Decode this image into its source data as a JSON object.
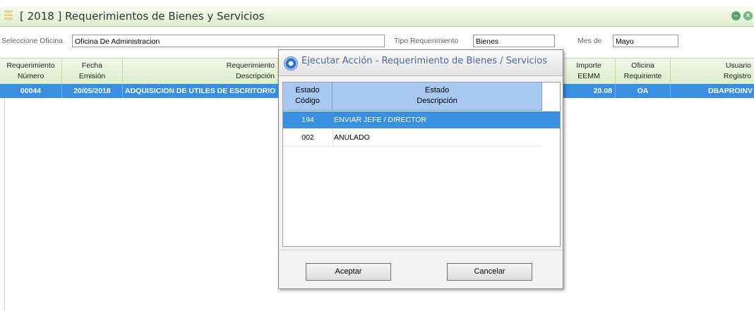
{
  "title": "[ 2018 ] Requerimientos de Bienes y Servicios",
  "filters": {
    "oficina_label": "Seleccione Oficina",
    "oficina_value": "Oficina De Administracion",
    "tipo_label": "Tipo Requerimiento",
    "tipo_value": "Bienes",
    "mes_label": "Mes de",
    "mes_value": "Mayo"
  },
  "grid": {
    "headers": [
      [
        "Requerimiento",
        "Número"
      ],
      [
        "Fecha",
        "Emisión"
      ],
      [
        "Requerimiento",
        "Descripción"
      ],
      [
        "Importe",
        "EEMM"
      ],
      [
        "Oficina",
        "Requiriente"
      ],
      [
        "Usuario",
        "Registro"
      ]
    ],
    "rows": [
      {
        "numero": "00044",
        "fecha": "20/05/2018",
        "descripcion": "ADQUISICION DE UTILES DE ESCRITORIO",
        "importe": "20.08",
        "oficina": "OA",
        "usuario": "DBAPROINV"
      }
    ]
  },
  "dialog": {
    "title": "Ejecutar Acción - Requerimiento de Bienes / Servicios",
    "headers": [
      [
        "Estado",
        "Código"
      ],
      [
        "Estado",
        "Descripción"
      ]
    ],
    "rows": [
      {
        "codigo": "194",
        "descripcion": "ENVIAR JEFE / DIRECTOR",
        "selected": true
      },
      {
        "codigo": "002",
        "descripcion": "ANULADO",
        "selected": false
      }
    ],
    "accept_label": "Aceptar",
    "cancel_label": "Cancelar"
  },
  "colors": {
    "selection": "#3b8fe0",
    "header_green": "#dcedc8",
    "dialog_header_blue": "#a7c8f2"
  }
}
